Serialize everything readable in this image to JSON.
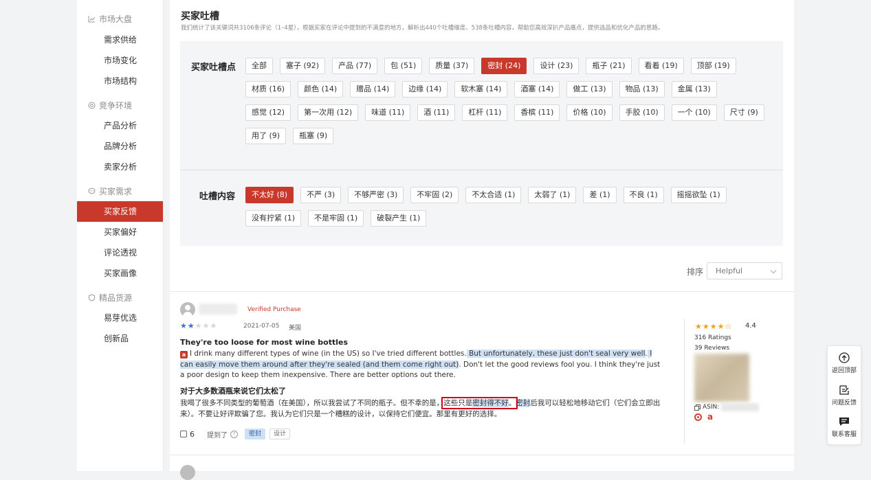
{
  "sidebar": {
    "groups": [
      {
        "label": "市场大盘",
        "icon": "chart-icon"
      },
      {
        "label": "竞争环境",
        "icon": "target-icon"
      },
      {
        "label": "买家需求",
        "icon": "chat-icon"
      },
      {
        "label": "精品货源",
        "icon": "shield-icon"
      }
    ],
    "items": [
      {
        "label": "需求供给"
      },
      {
        "label": "市场变化"
      },
      {
        "label": "市场结构"
      },
      {
        "label": "产品分析"
      },
      {
        "label": "品牌分析"
      },
      {
        "label": "卖家分析"
      },
      {
        "label": "买家反馈",
        "active": true
      },
      {
        "label": "买家偏好"
      },
      {
        "label": "评论透视"
      },
      {
        "label": "买家画像"
      },
      {
        "label": "易芽优选"
      },
      {
        "label": "创新品"
      }
    ]
  },
  "header": {
    "title": "买家吐槽",
    "description": "我们统计了该关键词共3106条评论（1–4星），根据买家在评论中提到的不满意的地方，解析出440个吐槽维度、538条吐槽内容，帮助您高效深扒产品痛点，提供选品和优化产品的思路。"
  },
  "complaint_points": {
    "label": "买家吐槽点",
    "tags": [
      "全部",
      "塞子 (92)",
      "产品 (77)",
      "包 (51)",
      "质量 (37)",
      "密封 (24)",
      "设计 (23)",
      "瓶子 (21)",
      "看着 (19)",
      "顶部 (19)",
      "材质 (16)",
      "颜色 (14)",
      "赠品 (14)",
      "边缘 (14)",
      "软木塞 (14)",
      "酒塞 (14)",
      "做工 (13)",
      "物品 (13)",
      "金属 (13)",
      "感觉 (12)",
      "第一次用 (12)",
      "味道 (11)",
      "酒 (11)",
      "杠杆 (11)",
      "香槟 (11)",
      "价格 (10)",
      "手胶 (10)",
      "一个 (10)",
      "尺寸 (9)",
      "用了 (9)",
      "瓶塞 (9)"
    ],
    "active": "密封 (24)"
  },
  "complaint_content": {
    "label": "吐槽内容",
    "tags": [
      "不太好 (8)",
      "不严 (3)",
      "不够严密 (3)",
      "不牢固 (2)",
      "不太合适 (1)",
      "太弱了 (1)",
      "差 (1)",
      "不良 (1)",
      "摇摇欲坠 (1)",
      "没有拧紧 (1)",
      "不是牢固 (1)",
      "破裂产生 (1)"
    ],
    "active": "不太好 (8)"
  },
  "sort": {
    "label": "排序",
    "value": "Helpful"
  },
  "review": {
    "verified": "Verified Purchase",
    "rating": 2,
    "date": "2021-07-05",
    "country": "美国",
    "title_en": "They're too loose for most wine bottles",
    "badge": "a",
    "body_en_1": "I drink many different types of wine (in the US) so I've tried different bottles.",
    "body_en_hl1": " But unfortunately, these just don't seal very well",
    "body_en_2": ".",
    "body_en_hl2": " I can easily move them around after they're sealed (and them come right out)",
    "body_en_3": ". Don't let the good reviews fool you. I think they're just a poor design to keep them inexpensive. There are better options out there.",
    "title_cn": "对于大多数酒瓶来说它们太松了",
    "body_cn_1": "我喝了很多不同类型的葡萄酒（在美国），所以我尝试了不同的瓶子。但不幸的是，",
    "body_cn_box_a": "这些只是",
    "body_cn_box_hl": "密封得不好",
    "body_cn_box_b": "。",
    "body_cn_hl2": "密封",
    "body_cn_2": "后我可以轻松地移动它们（它们会立即出来）。不要让好评欺骗了您。我认为它们只是一个糟糕的设计，以保持它们便宜。那里有更好的选择。",
    "likes": "6",
    "mention_label": "提到了",
    "mention_tags": [
      "密封",
      "设计"
    ]
  },
  "product": {
    "rating": "4.4",
    "stars": 4.4,
    "ratings": "316 Ratings",
    "reviews": "39 Reviews",
    "asin_label": "ASIN:"
  },
  "float_tools": [
    {
      "label": "返回顶部",
      "icon": "arrow-up-icon"
    },
    {
      "label": "问题反馈",
      "icon": "edit-icon"
    },
    {
      "label": "联系客服",
      "icon": "message-icon"
    }
  ]
}
